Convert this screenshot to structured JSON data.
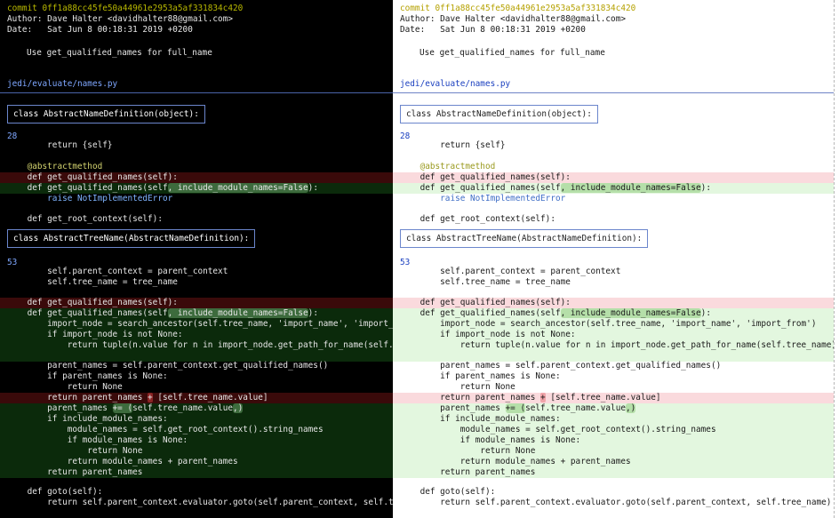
{
  "commit_line": "commit 0ff1a88cc45fe50a44961e2953a5af331834c420",
  "author_line": "Author: Dave Halter <davidhalter88@gmail.com>",
  "date_line": "Date:   Sat Jun 8 00:18:31 2019 +0200",
  "message": "Use get_qualified_names for full_name",
  "file_path": "jedi/evaluate/names.py",
  "hunk1": {
    "header": "class AbstractNameDefinition(object):",
    "line_number": "28"
  },
  "hunk2": {
    "header": "class AbstractTreeName(AbstractNameDefinition):",
    "line_number": "53"
  },
  "code": {
    "l1": "        return {self}",
    "l2": "    @abstractmethod",
    "l3_del": "    def get_qualified_names(self):",
    "l4_add_a": "    def get_qualified_names(self",
    "l4_add_b": ", include_module_names=False",
    "l4_add_c": "):",
    "l5": "        raise NotImplementedError",
    "l6": "    def get_root_context(self):",
    "m1": "        self.parent_context = parent_context",
    "m2": "        self.tree_name = tree_name",
    "m3_del": "    def get_qualified_names(self):",
    "m4_add_a": "    def get_qualified_names(self",
    "m4_add_b": ", include_module_names=False",
    "m4_add_c": "):",
    "m5": "        import_node = search_ancestor(self.tree_name, 'import_name', 'import_from')",
    "m6": "        if import_node is not None:",
    "m7": "            return tuple(n.value for n in import_node.get_path_for_name(self.tree_name))",
    "m8": "        parent_names = self.parent_context.get_qualified_names()",
    "m9": "        if parent_names is None:",
    "m10": "            return None",
    "m11_a": "        return parent_names ",
    "m11_b": "+",
    "m11_c": " [self.tree_name.value]",
    "m12_a": "        parent_names ",
    "m12_b": "+= (",
    "m12_c": "self.tree_name.value",
    "m12_d": ",)",
    "m13": "        if include_module_names:",
    "m14": "            module_names = self.get_root_context().string_names",
    "m15": "            if module_names is None:",
    "m16": "                return None",
    "m17": "            return module_names + parent_names",
    "m18": "        return parent_names",
    "m19": "    def goto(self):",
    "m20": "        return self.parent_context.evaluator.goto(self.parent_context, self.tree_name)"
  },
  "colors": {
    "dark_bg": "#000000",
    "light_bg": "#ffffff",
    "added_dark": "#0b2a0b",
    "removed_dark": "#3a0a0a",
    "added_light": "#e3f7df",
    "removed_light": "#fadadd"
  }
}
